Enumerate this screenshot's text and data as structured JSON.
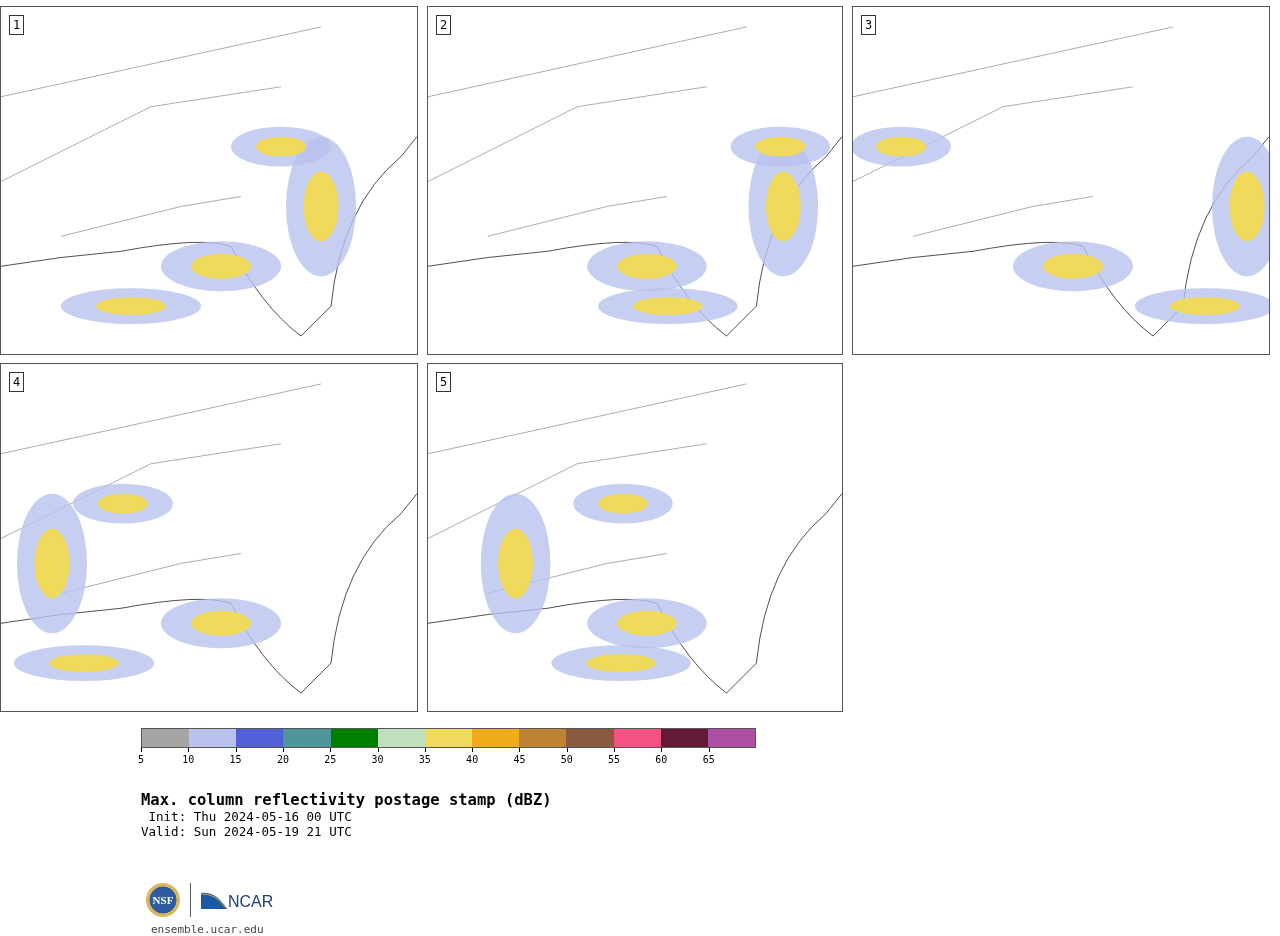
{
  "panels": [
    {
      "label": "1"
    },
    {
      "label": "2"
    },
    {
      "label": "3"
    },
    {
      "label": "4"
    },
    {
      "label": "5"
    }
  ],
  "colorbar": {
    "bins": [
      {
        "color": "#a5a5a5"
      },
      {
        "color": "#b8c2ed"
      },
      {
        "color": "#5160d4"
      },
      {
        "color": "#4e9699"
      },
      {
        "color": "#008000"
      },
      {
        "color": "#bfdfbf"
      },
      {
        "color": "#f0da5c"
      },
      {
        "color": "#f0ad19"
      },
      {
        "color": "#bd8332"
      },
      {
        "color": "#8b5a3e"
      },
      {
        "color": "#f55182"
      },
      {
        "color": "#621a37"
      },
      {
        "color": "#ae4fa6"
      }
    ],
    "ticks": [
      "5",
      "10",
      "15",
      "20",
      "25",
      "30",
      "35",
      "40",
      "45",
      "50",
      "55",
      "60",
      "65"
    ]
  },
  "title": "Max. column reflectivity postage stamp (dBZ)",
  "init": " Init: Thu 2024-05-16 00 UTC",
  "valid": "Valid: Sun 2024-05-19 21 UTC",
  "logo": {
    "seal_text": "NSF",
    "wordmark": "NCAR"
  },
  "url": "ensemble.ucar.edu"
}
